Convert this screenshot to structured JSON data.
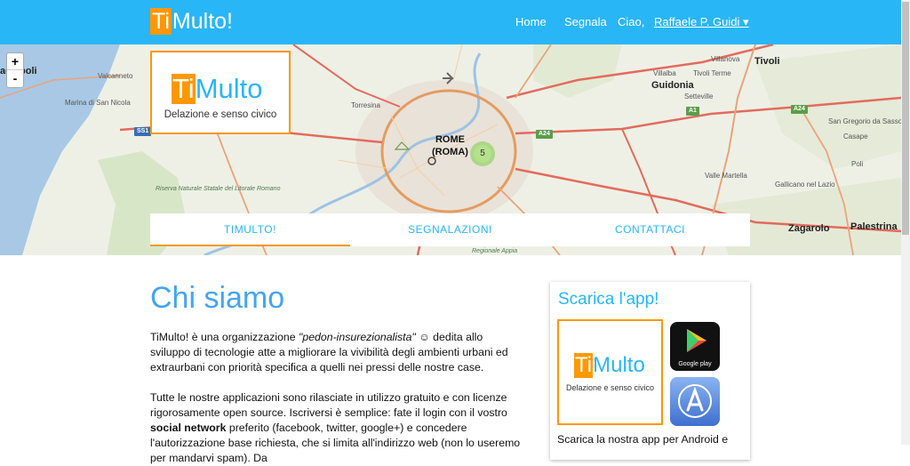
{
  "navbar": {
    "brand_ti": "Ti",
    "brand_rest": "Multo!",
    "home": "Home",
    "segnala": "Segnala",
    "greeting": "Ciao,",
    "user": "Raffaele P. Guidi ▾"
  },
  "map": {
    "zoom_in": "+",
    "zoom_out": "-",
    "cluster_count": "5",
    "labels": {
      "ladispoli": "adispoli",
      "valcanneto": "Valcanneto",
      "marina": "Marina di San Nicola",
      "torresina": "Torresina",
      "rome": "ROME",
      "roma": "(ROMA)",
      "villanova": "Villanova",
      "tivoli": "Tivoli",
      "villalba": "Villalba",
      "tivoli_terme": "Tivoli Terme",
      "guidonia": "Guidonia",
      "setteville": "Setteville",
      "san_gregorio": "San Gregorio da Sassola",
      "casape": "Casape",
      "poli": "Poli",
      "villa_martella": "Valle Martella",
      "gallicano": "Gallicano nel Lazio",
      "zagarolo": "Zagarolo",
      "palestrina": "Palestrina",
      "riserva": "Riserva Naturale Statale del Litorale Romano",
      "regionale_appia": "Regionale Appia"
    },
    "shields": {
      "ss1": "SS1",
      "a1": "A1",
      "a24a": "A24",
      "a24b": "A24"
    }
  },
  "hero_logo": {
    "ti": "Ti",
    "rest": "Multo",
    "subtitle": "Delazione e senso civico"
  },
  "tabs": {
    "timulto": "TIMULTO!",
    "segnalazioni": "SEGNALAZIONI",
    "contattaci": "CONTATTACI"
  },
  "content": {
    "title": "Chi siamo",
    "p1_a": "TiMulto! è una organizzazione ",
    "p1_em": "\"pedon-insurezionalista\"",
    "p1_b": " ☺ dedita allo sviluppo di tecnologie atte a migliorare la vivibilità degli ambienti urbani ed extraurbani con priorità specifica a quelli nei pressi delle nostre case.",
    "p2_a": "Tutte le nostre applicazioni sono rilasciate in utilizzo gratuito e con licenze rigorosamente open source. Iscriversi è semplice: fate il login con il vostro ",
    "p2_bold": "social network",
    "p2_b": " preferito (facebook, twitter, google+) e concedere l'autorizzazione base richiesta, che si limita all'indirizzo web (non lo useremo per mandarvi spam). Da"
  },
  "download_card": {
    "title": "Scarica l'app!",
    "logo_ti": "Ti",
    "logo_rest": "Multo",
    "logo_subtitle": "Delazione e senso civico",
    "text": "Scarica la nostra app per Android e",
    "google_play": "Google play"
  },
  "colors": {
    "primary": "#29b6f6",
    "accent": "#ff9800",
    "title": "#42a5f5"
  }
}
